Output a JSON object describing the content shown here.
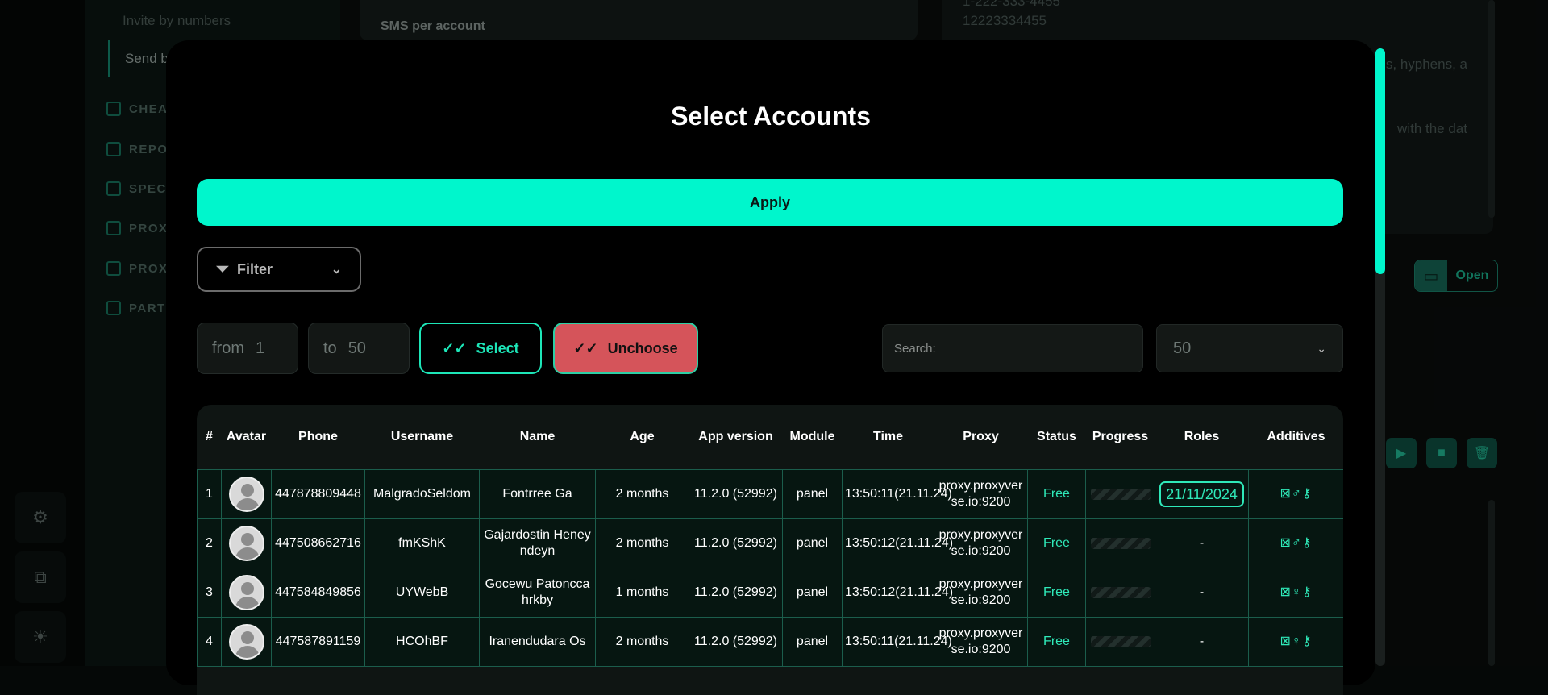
{
  "sidebar": {
    "sub_items": [
      "Invite by numbers",
      "Send b"
    ],
    "items": [
      {
        "label": "CHEA",
        "icon": "send-icon"
      },
      {
        "label": "REPO",
        "icon": "report-icon"
      },
      {
        "label": "SPEC",
        "icon": "special-icon"
      },
      {
        "label": "PROX",
        "icon": "proxy-icon"
      },
      {
        "label": "PROX",
        "icon": "proxy-icon"
      },
      {
        "label": "PART",
        "icon": "partner-icon"
      }
    ]
  },
  "rail": {
    "icons": [
      "settings-icon",
      "external-link-icon",
      "theme-icon"
    ]
  },
  "background": {
    "sms_label": "SMS per account",
    "right_lines": [
      "1-222-333-4455",
      "12223334455"
    ],
    "right_snippets": [
      "s, hyphens, a",
      "with the dat"
    ],
    "open_label": "Open"
  },
  "modal": {
    "title": "Select Accounts",
    "apply_label": "Apply",
    "filter_label": "Filter",
    "from_label": "from",
    "from_value": "1",
    "to_label": "to",
    "to_value": "50",
    "select_label": "Select",
    "unchoose_label": "Unchoose",
    "search_placeholder": "Search:",
    "page_size": "50"
  },
  "table": {
    "columns": [
      "#",
      "Avatar",
      "Phone",
      "Username",
      "Name",
      "Age",
      "App version",
      "Module",
      "Time",
      "Proxy",
      "Status",
      "Progress",
      "Roles",
      "Additives"
    ],
    "rows": [
      {
        "num": "1",
        "phone": "447878809448",
        "username": "MalgradoSeldom",
        "name": "Fontrree Ga",
        "age": "2 months",
        "app": "11.2.0 (52992)",
        "module": "panel",
        "time": "13:50:11(21.11.24)",
        "proxy": "proxy.proxyverse.io:9200",
        "status": "Free",
        "roles": "21/11/2024",
        "additives": "⊠♂⚷"
      },
      {
        "num": "2",
        "phone": "447508662716",
        "username": "fmKShK",
        "name": "Gajardostin Heneyndeyn",
        "age": "2 months",
        "app": "11.2.0 (52992)",
        "module": "panel",
        "time": "13:50:12(21.11.24)",
        "proxy": "proxy.proxyverse.io:9200",
        "status": "Free",
        "roles": "-",
        "additives": "⊠♂⚷"
      },
      {
        "num": "3",
        "phone": "447584849856",
        "username": "UYWebB",
        "name": "Gocewu Patonccahrkby",
        "age": "1 months",
        "app": "11.2.0 (52992)",
        "module": "panel",
        "time": "13:50:12(21.11.24)",
        "proxy": "proxy.proxyverse.io:9200",
        "status": "Free",
        "roles": "-",
        "additives": "⊠♀⚷"
      },
      {
        "num": "4",
        "phone": "447587891159",
        "username": "HCOhBF",
        "name": "Iranendudara Os",
        "age": "2 months",
        "app": "11.2.0 (52992)",
        "module": "panel",
        "time": "13:50:11(21.11.24)",
        "proxy": "proxy.proxyverse.io:9200",
        "status": "Free",
        "roles": "-",
        "additives": "⊠♀⚷"
      }
    ]
  }
}
